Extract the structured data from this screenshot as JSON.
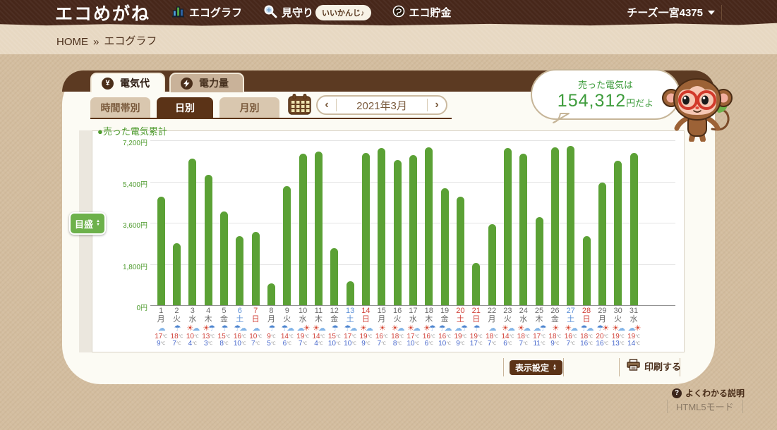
{
  "navbar": {
    "logo": "エコめがね",
    "items": [
      {
        "label": "エコグラフ",
        "icon": "bar-chart-icon"
      },
      {
        "label": "見守り",
        "icon": "magnifier-icon",
        "badge": "いいかんじ♪"
      },
      {
        "label": "エコ貯金",
        "icon": "coin-icon"
      }
    ],
    "account": "チーズ一宮4375"
  },
  "breadcrumb": {
    "home": "HOME",
    "separator": "»",
    "current": "エコグラフ"
  },
  "tabs": {
    "electricity_cost": "電気代",
    "electricity_amount": "電力量"
  },
  "subtabs": {
    "by_time": "時間帯別",
    "by_day": "日別",
    "by_month": "月別"
  },
  "date_nav": {
    "prev": "‹",
    "label": "2021年3月",
    "next": "›"
  },
  "bubble": {
    "line1": "売った電気は",
    "amount": "154,312",
    "suffix": "円だよ"
  },
  "scale_button": {
    "label": "目盛"
  },
  "buttons": {
    "display_settings": "表示設定",
    "print": "印刷する"
  },
  "page_links": {
    "help": "よくわかる説明",
    "mode": "HTML5モード"
  },
  "colors": {
    "bar": "#5ba135",
    "axis_label": "#4e9b2e",
    "weekday": "#6b6b6b",
    "saturday": "#5b8fd6",
    "sunday_holiday": "#d04038",
    "temp_high": "#d04038",
    "temp_low": "#4566cc",
    "sun_icon": "#d5412e",
    "cloud_icon": "#82b4e8",
    "rain_icon": "#4f86d0"
  },
  "chart_data": {
    "type": "bar",
    "legend": "●売った電気累計",
    "unit": "円",
    "ylim": [
      0,
      7200
    ],
    "yticks": [
      "7,200円",
      "5,400円",
      "3,600円",
      "1,800円",
      "0円"
    ],
    "grid": true,
    "days": [
      {
        "day": 1,
        "weekday": "月",
        "type": "weekday",
        "weather": "cloud",
        "high": 17,
        "low": 9,
        "value": 4750
      },
      {
        "day": 2,
        "weekday": "火",
        "type": "weekday",
        "weather": "rain",
        "high": 18,
        "low": 7,
        "value": 2700
      },
      {
        "day": 3,
        "weekday": "水",
        "type": "weekday",
        "weather": "sun-cloud",
        "high": 10,
        "low": 4,
        "value": 6400
      },
      {
        "day": 4,
        "weekday": "木",
        "type": "weekday",
        "weather": "sun-rain",
        "high": 13,
        "low": 3,
        "value": 5700
      },
      {
        "day": 5,
        "weekday": "金",
        "type": "weekday",
        "weather": "rain",
        "high": 15,
        "low": 8,
        "value": 4100
      },
      {
        "day": 6,
        "weekday": "土",
        "type": "sat",
        "weather": "rain-cloud",
        "high": 16,
        "low": 10,
        "value": 3000
      },
      {
        "day": 7,
        "weekday": "日",
        "type": "sun",
        "weather": "cloud",
        "high": 10,
        "low": 7,
        "value": 3200
      },
      {
        "day": 8,
        "weekday": "月",
        "type": "weekday",
        "weather": "rain",
        "high": 9,
        "low": 5,
        "value": 950
      },
      {
        "day": 9,
        "weekday": "火",
        "type": "weekday",
        "weather": "rain-cloud",
        "high": 14,
        "low": 6,
        "value": 5200
      },
      {
        "day": 10,
        "weekday": "水",
        "type": "weekday",
        "weather": "cloud-sun",
        "high": 19,
        "low": 7,
        "value": 6600
      },
      {
        "day": 11,
        "weekday": "木",
        "type": "weekday",
        "weather": "sun-cloud",
        "high": 14,
        "low": 4,
        "value": 6700
      },
      {
        "day": 12,
        "weekday": "金",
        "type": "weekday",
        "weather": "rain",
        "high": 15,
        "low": 10,
        "value": 2500
      },
      {
        "day": 13,
        "weekday": "土",
        "type": "sat",
        "weather": "rain-cloud",
        "high": 17,
        "low": 10,
        "value": 1050
      },
      {
        "day": 14,
        "weekday": "日",
        "type": "sun",
        "weather": "sun-cloud",
        "high": 19,
        "low": 9,
        "value": 6650
      },
      {
        "day": 15,
        "weekday": "月",
        "type": "weekday",
        "weather": "sun",
        "high": 16,
        "low": 7,
        "value": 6850
      },
      {
        "day": 16,
        "weekday": "火",
        "type": "weekday",
        "weather": "sun-cloud",
        "high": 18,
        "low": 8,
        "value": 6350
      },
      {
        "day": 17,
        "weekday": "水",
        "type": "weekday",
        "weather": "sun-cloud",
        "high": 17,
        "low": 10,
        "value": 6550
      },
      {
        "day": 18,
        "weekday": "木",
        "type": "weekday",
        "weather": "sun-rain",
        "high": 16,
        "low": 6,
        "value": 6900
      },
      {
        "day": 19,
        "weekday": "金",
        "type": "weekday",
        "weather": "rain-cloud",
        "high": 16,
        "low": 10,
        "value": 5100
      },
      {
        "day": 20,
        "weekday": "土",
        "type": "holiday",
        "weather": "cloud-rain",
        "high": 19,
        "low": 9,
        "value": 4750
      },
      {
        "day": 21,
        "weekday": "日",
        "type": "sun",
        "weather": "rain",
        "high": 19,
        "low": 17,
        "value": 1850
      },
      {
        "day": 22,
        "weekday": "月",
        "type": "weekday",
        "weather": "cloud",
        "high": 18,
        "low": 7,
        "value": 3550
      },
      {
        "day": 23,
        "weekday": "火",
        "type": "weekday",
        "weather": "sun-cloud",
        "high": 14,
        "low": 6,
        "value": 6850
      },
      {
        "day": 24,
        "weekday": "水",
        "type": "weekday",
        "weather": "sun-cloud",
        "high": 18,
        "low": 7,
        "value": 6600
      },
      {
        "day": 25,
        "weekday": "木",
        "type": "weekday",
        "weather": "cloud-rain",
        "high": 17,
        "low": 11,
        "value": 3850
      },
      {
        "day": 26,
        "weekday": "金",
        "type": "weekday",
        "weather": "sun",
        "high": 18,
        "low": 9,
        "value": 6900
      },
      {
        "day": 27,
        "weekday": "土",
        "type": "sat",
        "weather": "sun-cloud",
        "high": 16,
        "low": 7,
        "value": 6950
      },
      {
        "day": 28,
        "weekday": "日",
        "type": "sun",
        "weather": "rain-cloud",
        "high": 18,
        "low": 16,
        "value": 3000
      },
      {
        "day": 29,
        "weekday": "月",
        "type": "weekday",
        "weather": "rain-sun",
        "high": 20,
        "low": 16,
        "value": 5350
      },
      {
        "day": 30,
        "weekday": "火",
        "type": "weekday",
        "weather": "sun-cloud",
        "high": 19,
        "low": 13,
        "value": 6300
      },
      {
        "day": 31,
        "weekday": "水",
        "type": "weekday",
        "weather": "cloud-sun",
        "high": 19,
        "low": 14,
        "value": 6650
      }
    ]
  }
}
